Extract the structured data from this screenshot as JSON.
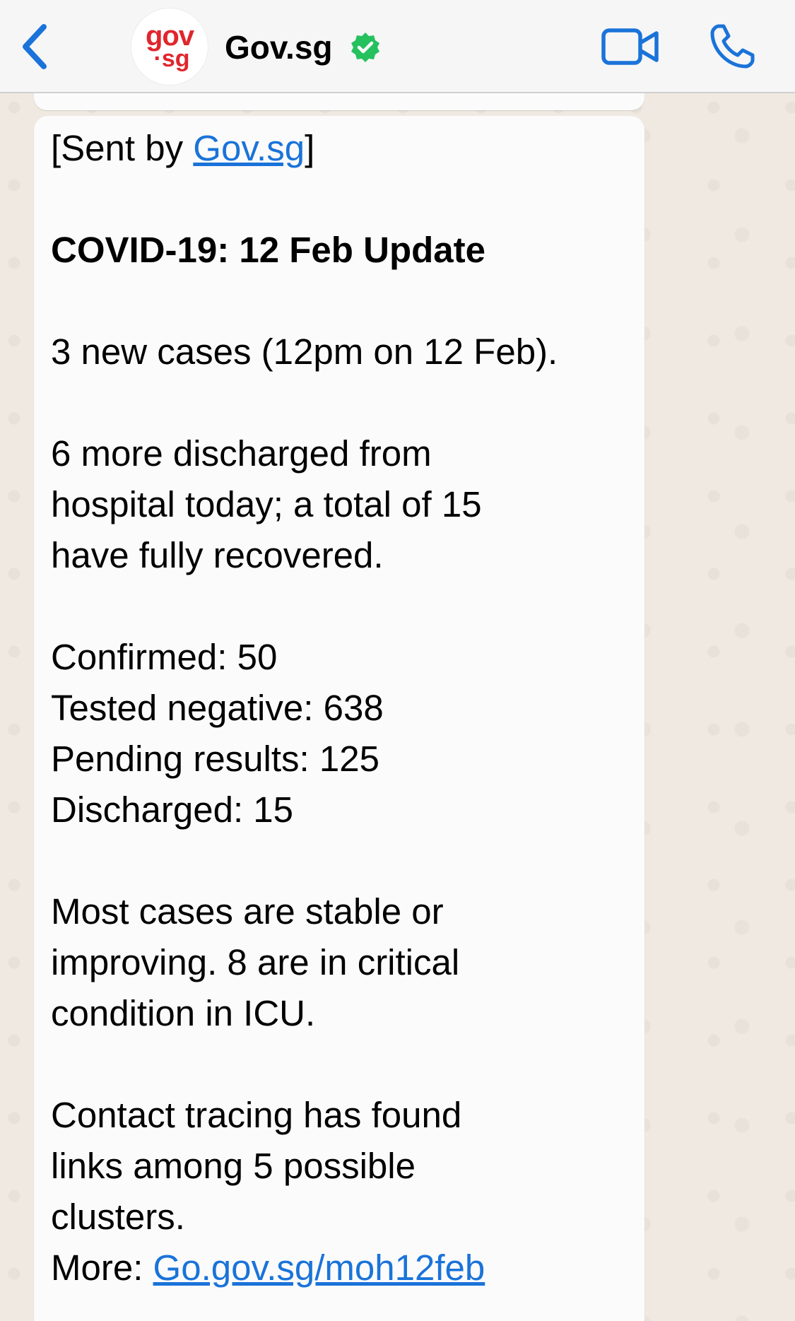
{
  "header": {
    "contact_name": "Gov.sg",
    "avatar_logo_top": "gov",
    "avatar_logo_bottom": "sg",
    "icons": {
      "back": "chevron-left-icon",
      "verified": "verified-badge-icon",
      "video": "video-camera-icon",
      "call": "phone-icon"
    },
    "colors": {
      "accent": "#1a73d9",
      "verified": "#25c15f",
      "logo": "#e0262d"
    }
  },
  "message": {
    "sent_by_prefix": "[Sent by ",
    "sent_by_link": "Gov.sg",
    "sent_by_suffix": "]",
    "title": "COVID-19: 12 Feb Update",
    "new_cases": "3 new cases (12pm on 12 Feb).",
    "discharged_lines": [
      "6 more discharged from",
      "hospital today; a total of 15",
      "have fully recovered."
    ],
    "stats": [
      "Confirmed: 50",
      "Tested negative: 638",
      "Pending results: 125",
      "Discharged: 15"
    ],
    "condition_lines": [
      "Most cases are stable or",
      "improving. 8 are in critical",
      "condition in ICU."
    ],
    "tracing_lines": [
      "Contact tracing has found",
      "links among 5 possible",
      "clusters."
    ],
    "more_prefix": "More: ",
    "more_link": "Go.gov.sg/moh12feb"
  }
}
